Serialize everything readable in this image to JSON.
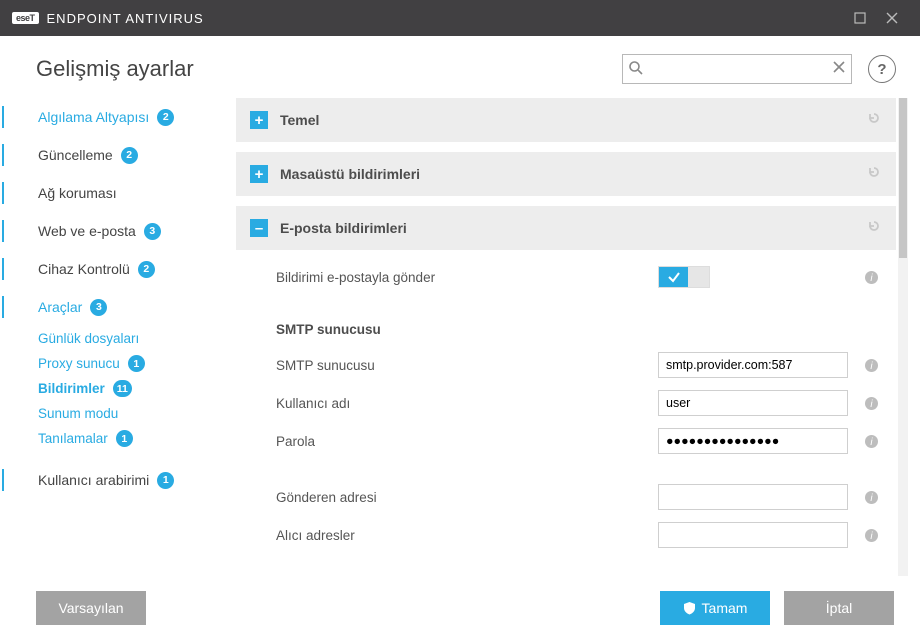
{
  "titlebar": {
    "brand_badge": "eseT",
    "brand_text": "ENDPOINT ANTIVIRUS"
  },
  "header": {
    "title": "Gelişmiş ayarlar",
    "search_placeholder": "",
    "help": "?"
  },
  "sidebar": {
    "items": [
      {
        "label": "Algılama Altyapısı",
        "badge": "2"
      },
      {
        "label": "Güncelleme",
        "badge": "2"
      },
      {
        "label": "Ağ koruması",
        "badge": ""
      },
      {
        "label": "Web ve e-posta",
        "badge": "3"
      },
      {
        "label": "Cihaz Kontrolü",
        "badge": "2"
      },
      {
        "label": "Araçlar",
        "badge": "3"
      }
    ],
    "sub": [
      {
        "label": "Günlük dosyaları",
        "badge": ""
      },
      {
        "label": "Proxy sunucu",
        "badge": "1"
      },
      {
        "label": "Bildirimler",
        "badge": "11"
      },
      {
        "label": "Sunum modu",
        "badge": ""
      },
      {
        "label": "Tanılamalar",
        "badge": "1"
      }
    ],
    "tail": {
      "label": "Kullanıcı arabirimi",
      "badge": "1"
    }
  },
  "sections": {
    "s0": {
      "title": "Temel"
    },
    "s1": {
      "title": "Masaüstü bildirimleri"
    },
    "s2": {
      "title": "E-posta bildirimleri"
    }
  },
  "email": {
    "toggle_label": "Bildirimi e-postayla gönder",
    "group_label": "SMTP sunucusu",
    "server_label": "SMTP sunucusu",
    "server_value": "smtp.provider.com:587",
    "user_label": "Kullanıcı adı",
    "user_value": "user",
    "pass_label": "Parola",
    "pass_value": "●●●●●●●●●●●●●●●",
    "from_label": "Gönderen adresi",
    "from_value": "",
    "to_label": "Alıcı adresler",
    "to_value": ""
  },
  "footer": {
    "default": "Varsayılan",
    "ok": "Tamam",
    "cancel": "İptal"
  }
}
